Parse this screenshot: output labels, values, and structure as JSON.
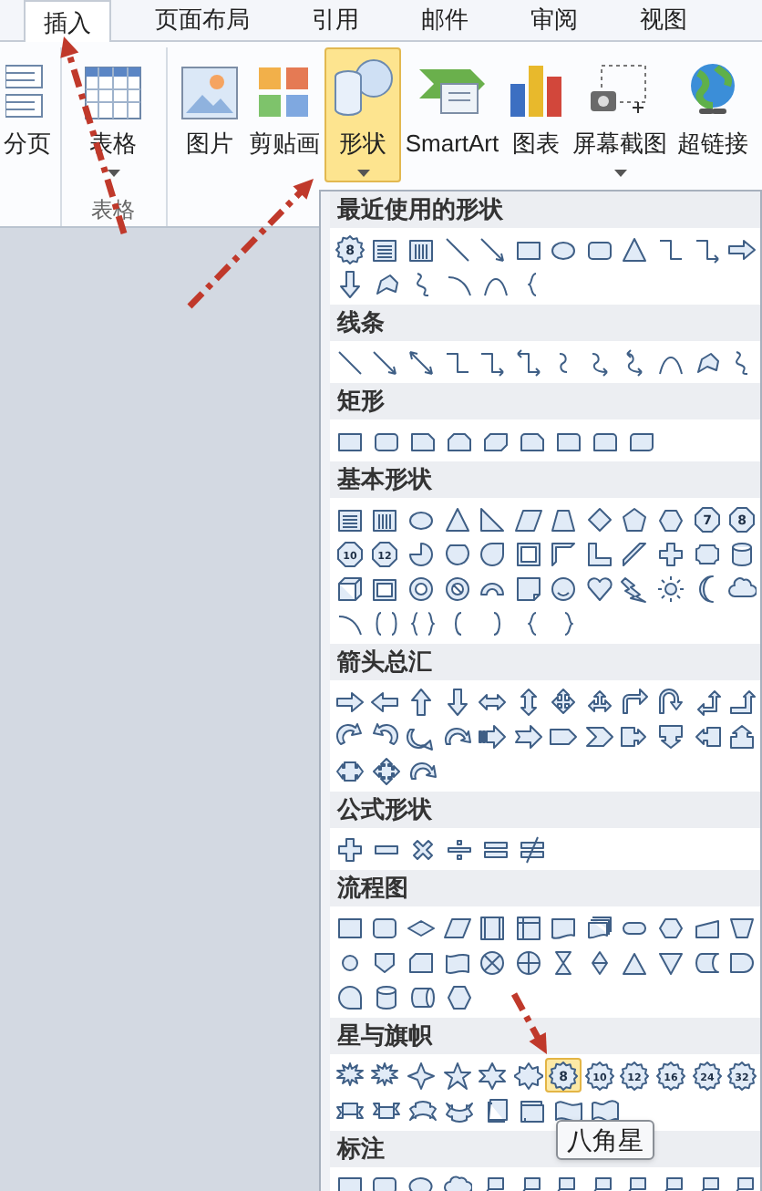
{
  "tabs": [
    {
      "label": "插入",
      "selected": true
    },
    {
      "label": "页面布局",
      "selected": false
    },
    {
      "label": "引用",
      "selected": false
    },
    {
      "label": "邮件",
      "selected": false
    },
    {
      "label": "审阅",
      "selected": false
    },
    {
      "label": "视图",
      "selected": false
    }
  ],
  "ribbon": {
    "buttons": [
      {
        "label": "分页",
        "kind": "page-break",
        "dropdown": false,
        "selected": false
      },
      {
        "label": "表格",
        "kind": "table",
        "dropdown": true,
        "selected": false
      },
      {
        "label": "图片",
        "kind": "picture",
        "dropdown": false,
        "selected": false
      },
      {
        "label": "剪贴画",
        "kind": "clip-art",
        "dropdown": false,
        "selected": false
      },
      {
        "label": "形状",
        "kind": "shapes",
        "dropdown": true,
        "selected": true
      },
      {
        "label": "SmartArt",
        "kind": "smartart",
        "dropdown": false,
        "selected": false
      },
      {
        "label": "图表",
        "kind": "chart",
        "dropdown": false,
        "selected": false
      },
      {
        "label": "屏幕截图",
        "kind": "screenshot",
        "dropdown": true,
        "selected": false
      },
      {
        "label": "超链接",
        "kind": "hyperlink",
        "dropdown": false,
        "selected": false
      }
    ],
    "group_labels": [
      "表格"
    ]
  },
  "shapes_gallery": {
    "sections": [
      {
        "title": "最近使用的形状",
        "rows": [
          [
            {
              "kind": "seal",
              "label": "8",
              "selected": false
            },
            {
              "kind": "text-box",
              "selected": false
            },
            {
              "kind": "vertical-text-box",
              "selected": false
            },
            {
              "kind": "line",
              "selected": false
            },
            {
              "kind": "arrow-line",
              "selected": false
            },
            {
              "kind": "rectangle",
              "selected": false
            },
            {
              "kind": "oval",
              "selected": false
            },
            {
              "kind": "rounded-rectangle",
              "selected": false
            },
            {
              "kind": "triangle",
              "selected": false
            },
            {
              "kind": "elbow-connector",
              "selected": false
            },
            {
              "kind": "elbow-arrow",
              "selected": false
            },
            {
              "kind": "right-arrow",
              "selected": false
            }
          ],
          [
            {
              "kind": "down-arrow",
              "selected": false
            },
            {
              "kind": "freeform",
              "selected": false
            },
            {
              "kind": "scribble",
              "selected": false
            },
            {
              "kind": "arc",
              "selected": false
            },
            {
              "kind": "curve",
              "selected": false
            },
            {
              "kind": "left-brace",
              "selected": false
            }
          ]
        ]
      },
      {
        "title": "线条",
        "rows": [
          [
            {
              "kind": "line",
              "selected": false
            },
            {
              "kind": "arrow-line",
              "selected": false
            },
            {
              "kind": "double-arrow-line",
              "selected": false
            },
            {
              "kind": "elbow-connector",
              "selected": false
            },
            {
              "kind": "elbow-arrow",
              "selected": false
            },
            {
              "kind": "elbow-double-arrow",
              "selected": false
            },
            {
              "kind": "curved-connector",
              "selected": false
            },
            {
              "kind": "curved-arrow",
              "selected": false
            },
            {
              "kind": "curved-double-arrow",
              "selected": false
            },
            {
              "kind": "curve",
              "selected": false
            },
            {
              "kind": "freeform",
              "selected": false
            },
            {
              "kind": "scribble",
              "selected": false
            }
          ]
        ]
      },
      {
        "title": "矩形",
        "rows": [
          [
            {
              "kind": "rectangle",
              "selected": false
            },
            {
              "kind": "rounded-rectangle",
              "selected": false
            },
            {
              "kind": "snip-corner-rectangle",
              "selected": false
            },
            {
              "kind": "snip-corners-rectangle",
              "selected": false
            },
            {
              "kind": "snip-diagonal-rectangle",
              "selected": false
            },
            {
              "kind": "snip-round-rectangle",
              "selected": false
            },
            {
              "kind": "round-corner-rectangle",
              "selected": false
            },
            {
              "kind": "round-corners-rectangle",
              "selected": false
            },
            {
              "kind": "round-diagonal-rectangle",
              "selected": false
            }
          ]
        ]
      },
      {
        "title": "基本形状",
        "rows": [
          [
            {
              "kind": "text-box",
              "selected": false
            },
            {
              "kind": "vertical-text-box",
              "selected": false
            },
            {
              "kind": "oval",
              "selected": false
            },
            {
              "kind": "triangle",
              "selected": false
            },
            {
              "kind": "right-triangle",
              "selected": false
            },
            {
              "kind": "parallelogram",
              "selected": false
            },
            {
              "kind": "trapezoid",
              "selected": false
            },
            {
              "kind": "diamond",
              "selected": false
            },
            {
              "kind": "pentagon",
              "selected": false
            },
            {
              "kind": "hexagon",
              "selected": false
            },
            {
              "kind": "heptagon",
              "label": "7",
              "selected": false
            },
            {
              "kind": "octagon",
              "label": "8",
              "selected": false
            }
          ],
          [
            {
              "kind": "decagon",
              "label": "10",
              "selected": false
            },
            {
              "kind": "dodecagon",
              "label": "12",
              "selected": false
            },
            {
              "kind": "pie",
              "selected": false
            },
            {
              "kind": "chord",
              "selected": false
            },
            {
              "kind": "teardrop",
              "selected": false
            },
            {
              "kind": "frame",
              "selected": false
            },
            {
              "kind": "half-frame",
              "selected": false
            },
            {
              "kind": "l-shape",
              "selected": false
            },
            {
              "kind": "diagonal-stripe",
              "selected": false
            },
            {
              "kind": "cross",
              "selected": false
            },
            {
              "kind": "plaque",
              "selected": false
            },
            {
              "kind": "can",
              "selected": false
            }
          ],
          [
            {
              "kind": "cube",
              "selected": false
            },
            {
              "kind": "bevel",
              "selected": false
            },
            {
              "kind": "donut",
              "selected": false
            },
            {
              "kind": "no-symbol",
              "selected": false
            },
            {
              "kind": "block-arc",
              "selected": false
            },
            {
              "kind": "folded-corner",
              "selected": false
            },
            {
              "kind": "smiley",
              "selected": false
            },
            {
              "kind": "heart",
              "selected": false
            },
            {
              "kind": "lightning",
              "selected": false
            },
            {
              "kind": "sun",
              "selected": false
            },
            {
              "kind": "moon",
              "selected": false
            },
            {
              "kind": "cloud",
              "selected": false
            }
          ],
          [
            {
              "kind": "arc",
              "selected": false
            },
            {
              "kind": "bracket-pair",
              "selected": false
            },
            {
              "kind": "brace-pair",
              "selected": false
            },
            {
              "kind": "left-bracket",
              "selected": false
            },
            {
              "kind": "right-bracket",
              "selected": false
            },
            {
              "kind": "left-brace",
              "selected": false
            },
            {
              "kind": "right-brace",
              "selected": false
            }
          ]
        ]
      },
      {
        "title": "箭头总汇",
        "rows": [
          [
            {
              "kind": "right-arrow",
              "selected": false
            },
            {
              "kind": "left-arrow",
              "selected": false
            },
            {
              "kind": "up-arrow",
              "selected": false
            },
            {
              "kind": "down-arrow",
              "selected": false
            },
            {
              "kind": "left-right-arrow",
              "selected": false
            },
            {
              "kind": "up-down-arrow",
              "selected": false
            },
            {
              "kind": "quad-arrow",
              "selected": false
            },
            {
              "kind": "left-right-up-arrow",
              "selected": false
            },
            {
              "kind": "bent-arrow",
              "selected": false
            },
            {
              "kind": "u-turn-arrow",
              "selected": false
            },
            {
              "kind": "left-up-arrow",
              "selected": false
            },
            {
              "kind": "bent-up-arrow",
              "selected": false
            }
          ],
          [
            {
              "kind": "curved-right-arrow",
              "selected": false
            },
            {
              "kind": "curved-left-arrow",
              "selected": false
            },
            {
              "kind": "curved-up-arrow",
              "selected": false
            },
            {
              "kind": "curved-down-arrow",
              "selected": false
            },
            {
              "kind": "striped-right-arrow",
              "selected": false
            },
            {
              "kind": "notched-right-arrow",
              "selected": false
            },
            {
              "kind": "pentagon-arrow",
              "selected": false
            },
            {
              "kind": "chevron",
              "selected": false
            },
            {
              "kind": "right-arrow-callout",
              "selected": false
            },
            {
              "kind": "down-arrow-callout",
              "selected": false
            },
            {
              "kind": "left-arrow-callout",
              "selected": false
            },
            {
              "kind": "up-arrow-callout",
              "selected": false
            }
          ],
          [
            {
              "kind": "left-right-arrow-callout",
              "selected": false
            },
            {
              "kind": "quad-arrow-callout",
              "selected": false
            },
            {
              "kind": "circular-arrow",
              "selected": false
            }
          ]
        ]
      },
      {
        "title": "公式形状",
        "rows": [
          [
            {
              "kind": "plus",
              "selected": false
            },
            {
              "kind": "minus",
              "selected": false
            },
            {
              "kind": "multiply",
              "selected": false
            },
            {
              "kind": "divide",
              "selected": false
            },
            {
              "kind": "equal",
              "selected": false
            },
            {
              "kind": "not-equal",
              "selected": false
            }
          ]
        ]
      },
      {
        "title": "流程图",
        "rows": [
          [
            {
              "kind": "process",
              "selected": false
            },
            {
              "kind": "alternate-process",
              "selected": false
            },
            {
              "kind": "decision",
              "selected": false
            },
            {
              "kind": "data",
              "selected": false
            },
            {
              "kind": "predefined-process",
              "selected": false
            },
            {
              "kind": "internal-storage",
              "selected": false
            },
            {
              "kind": "document",
              "selected": false
            },
            {
              "kind": "multidocument",
              "selected": false
            },
            {
              "kind": "terminator",
              "selected": false
            },
            {
              "kind": "preparation",
              "selected": false
            },
            {
              "kind": "manual-input",
              "selected": false
            },
            {
              "kind": "manual-operation",
              "selected": false
            }
          ],
          [
            {
              "kind": "connector",
              "selected": false
            },
            {
              "kind": "off-page-connector",
              "selected": false
            },
            {
              "kind": "card",
              "selected": false
            },
            {
              "kind": "punched-tape",
              "selected": false
            },
            {
              "kind": "summing-junction",
              "selected": false
            },
            {
              "kind": "or",
              "selected": false
            },
            {
              "kind": "collate",
              "selected": false
            },
            {
              "kind": "sort",
              "selected": false
            },
            {
              "kind": "extract",
              "selected": false
            },
            {
              "kind": "merge",
              "selected": false
            },
            {
              "kind": "stored-data",
              "selected": false
            },
            {
              "kind": "delay",
              "selected": false
            }
          ],
          [
            {
              "kind": "sequential-access",
              "selected": false
            },
            {
              "kind": "magnetic-disk",
              "selected": false
            },
            {
              "kind": "direct-access",
              "selected": false
            },
            {
              "kind": "display",
              "selected": false
            }
          ]
        ]
      },
      {
        "title": "星与旗帜",
        "rows": [
          [
            {
              "kind": "explosion",
              "selected": false
            },
            {
              "kind": "explosion",
              "selected": false
            },
            {
              "kind": "star-4",
              "selected": false
            },
            {
              "kind": "star-5",
              "selected": false
            },
            {
              "kind": "star-6",
              "selected": false
            },
            {
              "kind": "star-7",
              "selected": false
            },
            {
              "kind": "seal",
              "label": "8",
              "selected": true
            },
            {
              "kind": "seal",
              "label": "10",
              "selected": false
            },
            {
              "kind": "seal",
              "label": "12",
              "selected": false
            },
            {
              "kind": "seal",
              "label": "16",
              "selected": false
            },
            {
              "kind": "seal",
              "label": "24",
              "selected": false
            },
            {
              "kind": "seal",
              "label": "32",
              "selected": false
            }
          ],
          [
            {
              "kind": "ribbon-up",
              "selected": false
            },
            {
              "kind": "ribbon-down",
              "selected": false
            },
            {
              "kind": "curved-ribbon-up",
              "selected": false
            },
            {
              "kind": "curved-ribbon-down",
              "selected": false
            },
            {
              "kind": "vertical-scroll",
              "selected": false
            },
            {
              "kind": "horizontal-scroll",
              "selected": false
            },
            {
              "kind": "wave",
              "selected": false
            },
            {
              "kind": "double-wave",
              "selected": false
            }
          ]
        ]
      },
      {
        "title": "标注",
        "rows": [
          [
            {
              "kind": "rectangular-callout",
              "selected": false
            },
            {
              "kind": "rounded-callout",
              "selected": false
            },
            {
              "kind": "oval-callout",
              "selected": false
            },
            {
              "kind": "cloud-callout",
              "selected": false
            },
            {
              "kind": "line-callout",
              "selected": false
            },
            {
              "kind": "line-callout",
              "selected": false
            },
            {
              "kind": "line-callout",
              "selected": false
            },
            {
              "kind": "line-callout",
              "selected": false
            },
            {
              "kind": "line-callout",
              "selected": false
            },
            {
              "kind": "line-callout",
              "selected": false
            },
            {
              "kind": "line-callout",
              "selected": false
            },
            {
              "kind": "line-callout",
              "selected": false
            }
          ]
        ]
      }
    ]
  },
  "tooltip": "八角星"
}
